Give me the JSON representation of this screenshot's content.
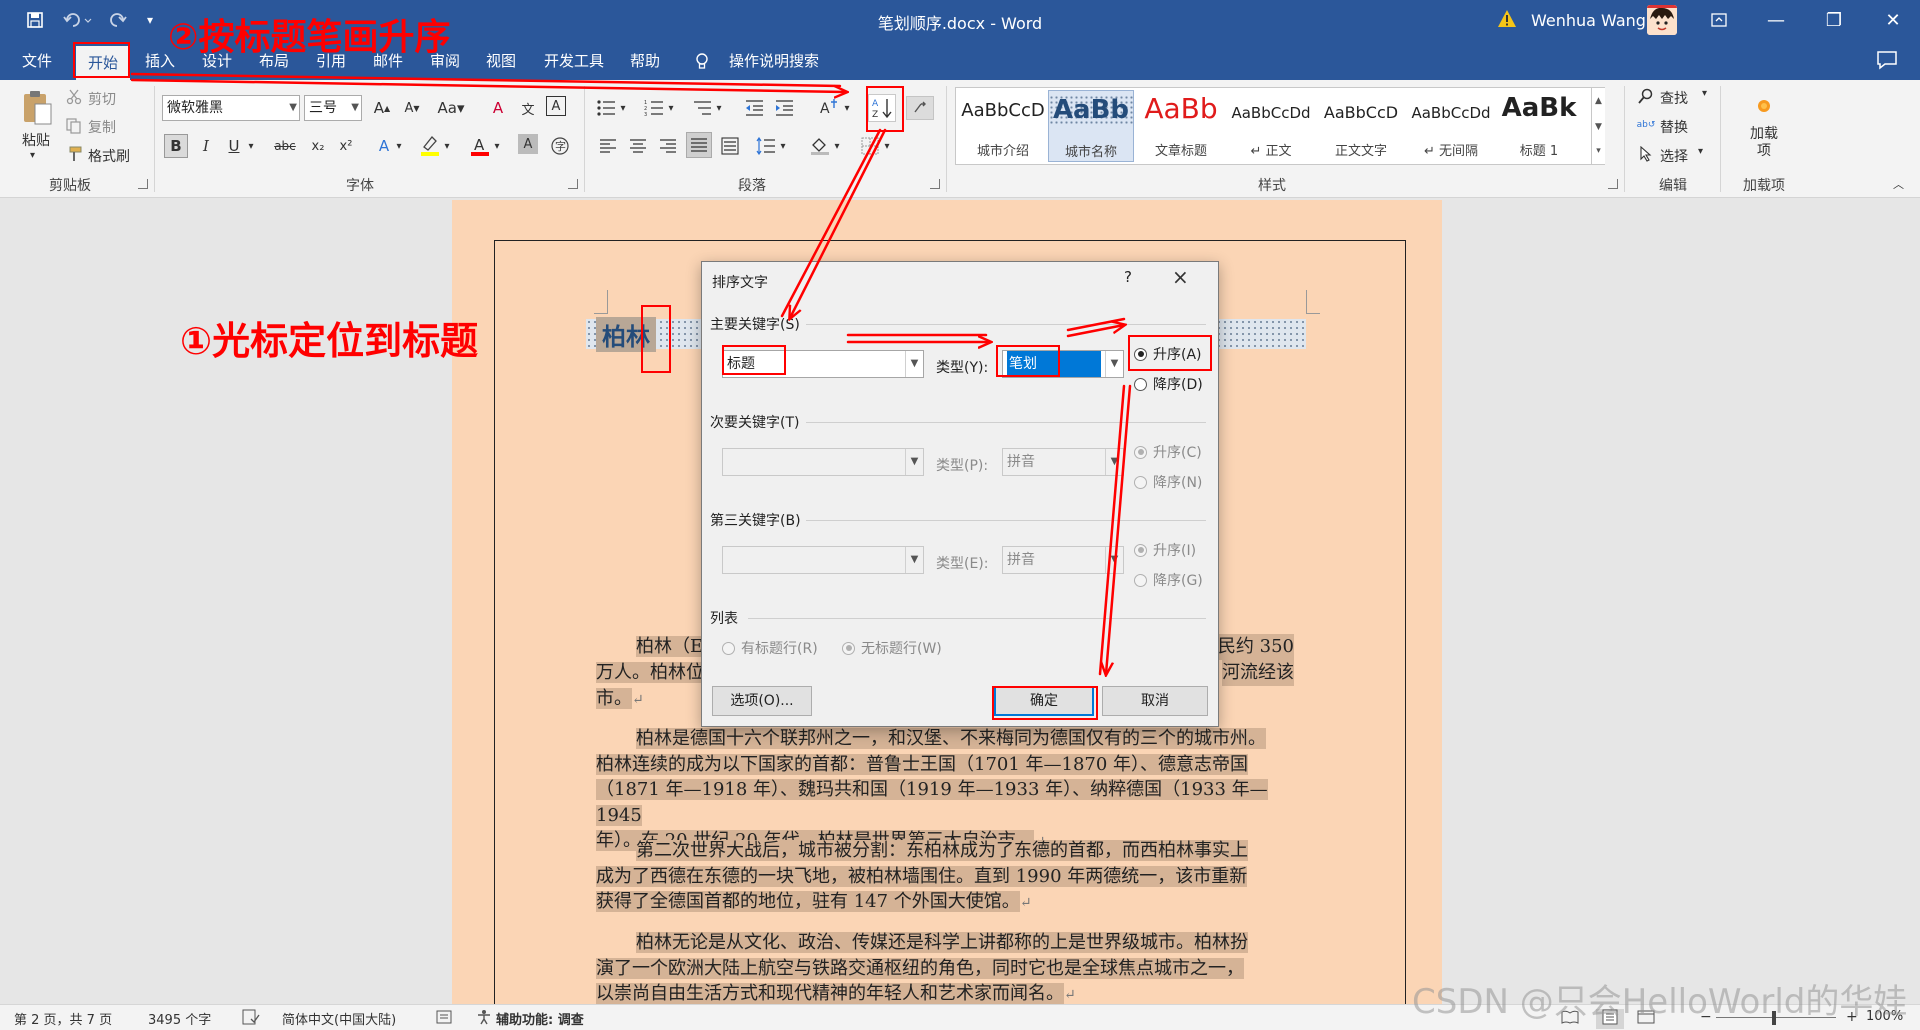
{
  "window": {
    "title": "笔划顺序.docx  -  Word",
    "user": "Wenhua Wang",
    "minimize_glyph": "—",
    "restore_glyph": "❐",
    "close_glyph": "✕"
  },
  "menu": {
    "tabs": [
      "文件",
      "开始",
      "插入",
      "设计",
      "布局",
      "引用",
      "邮件",
      "审阅",
      "视图",
      "开发工具",
      "帮助"
    ],
    "active_tab": "开始",
    "tell_me": "操作说明搜索"
  },
  "ribbon": {
    "clipboard": {
      "label": "剪贴板",
      "paste": "粘贴",
      "cut": "剪切",
      "copy": "复制",
      "format_painter": "格式刷"
    },
    "font": {
      "label": "字体",
      "name": "微软雅黑",
      "size": "三号",
      "bold": "B",
      "italic": "I",
      "underline": "U",
      "strike": "abc",
      "subscript": "x₂",
      "superscript": "x²"
    },
    "paragraph": {
      "label": "段落"
    },
    "styles": {
      "label": "样式",
      "items": [
        {
          "sample": "AaBbCcD",
          "name": "城市介绍"
        },
        {
          "sample": "AaBb",
          "name": "城市名称"
        },
        {
          "sample": "AaBb",
          "name": "文章标题"
        },
        {
          "sample": "AaBbCcDd",
          "name": "↵ 正文"
        },
        {
          "sample": "AaBbCcD",
          "name": "正文文字"
        },
        {
          "sample": "AaBbCcDd",
          "name": "↵ 无间隔"
        },
        {
          "sample": "AaBk",
          "name": "标题 1"
        }
      ],
      "selected_index": 1
    },
    "editing": {
      "label": "编辑",
      "find": "查找",
      "replace": "替换",
      "select": "选择"
    },
    "addins": {
      "label": "加载项",
      "button": "加载项"
    }
  },
  "document": {
    "heading": "柏林",
    "paragraphs": [
      {
        "text": "柏林（E",
        "text_right": "居民约 350",
        "line2_left": "万人。柏林位",
        "line2_right": "河流经该",
        "line3": "市。"
      },
      {
        "lines": [
          "柏林是德国十六个联邦州之一，和汉堡、不来梅同为德国仅有的三个的城市州。",
          "柏林连续的成为以下国家的首都：普鲁士王国（1701 年—1870 年）、德意志帝国",
          "（1871 年—1918 年）、魏玛共和国（1919 年—1933 年）、纳粹德国（1933 年—1945",
          "年）。在 20 世纪 20 年代，柏林是世界第三大自治市。"
        ]
      },
      {
        "lines": [
          "第二次世界大战后，城市被分割：东柏林成为了东德的首都，而西柏林事实上",
          "成为了西德在东德的一块飞地，被柏林墙围住。直到 1990 年两德统一，该市重新",
          "获得了全德国首都的地位，驻有 147 个外国大使馆。"
        ]
      },
      {
        "lines": [
          "柏林无论是从文化、政治、传媒还是科学上讲都称的上是世界级城市。柏林扮",
          "演了一个欧洲大陆上航空与铁路交通枢纽的角色，同时它也是全球焦点城市之一，",
          "以崇尚自由生活方式和现代精神的年轻人和艺术家而闻名。"
        ]
      }
    ]
  },
  "dialog": {
    "title": "排序文字",
    "help": "?",
    "primary_key_label": "主要关键字(S)",
    "primary_key_value": "标题",
    "primary_type_label": "类型(Y):",
    "primary_type_value": "笔划",
    "asc_a": "升序(A)",
    "desc_d": "降序(D)",
    "secondary_key_label": "次要关键字(T)",
    "secondary_type_label": "类型(P):",
    "secondary_type_value": "拼音",
    "asc_c": "升序(C)",
    "desc_n": "降序(N)",
    "third_key_label": "第三关键字(B)",
    "third_type_label": "类型(E):",
    "third_type_value": "拼音",
    "asc_i": "升序(I)",
    "desc_g": "降序(G)",
    "list_label": "列表",
    "has_header": "有标题行(R)",
    "no_header": "无标题行(W)",
    "options_button": "选项(O)...",
    "ok_button": "确定",
    "cancel_button": "取消"
  },
  "status": {
    "page": "第 2 页，共 7 页",
    "words": "3495 个字",
    "language": "简体中文(中国大陆)",
    "accessibility": "辅助功能: 调查",
    "zoom": "100%"
  },
  "annotations": {
    "step1": "①光标定位到标题",
    "step2": "②按标题笔画升序"
  },
  "watermark": "CSDN @只会HelloWorld的华娃",
  "colors": {
    "titlebar": "#2b579a",
    "ribbon": "#f3f3f3",
    "page": "#fbd5b5",
    "annotation": "#ff0000"
  }
}
